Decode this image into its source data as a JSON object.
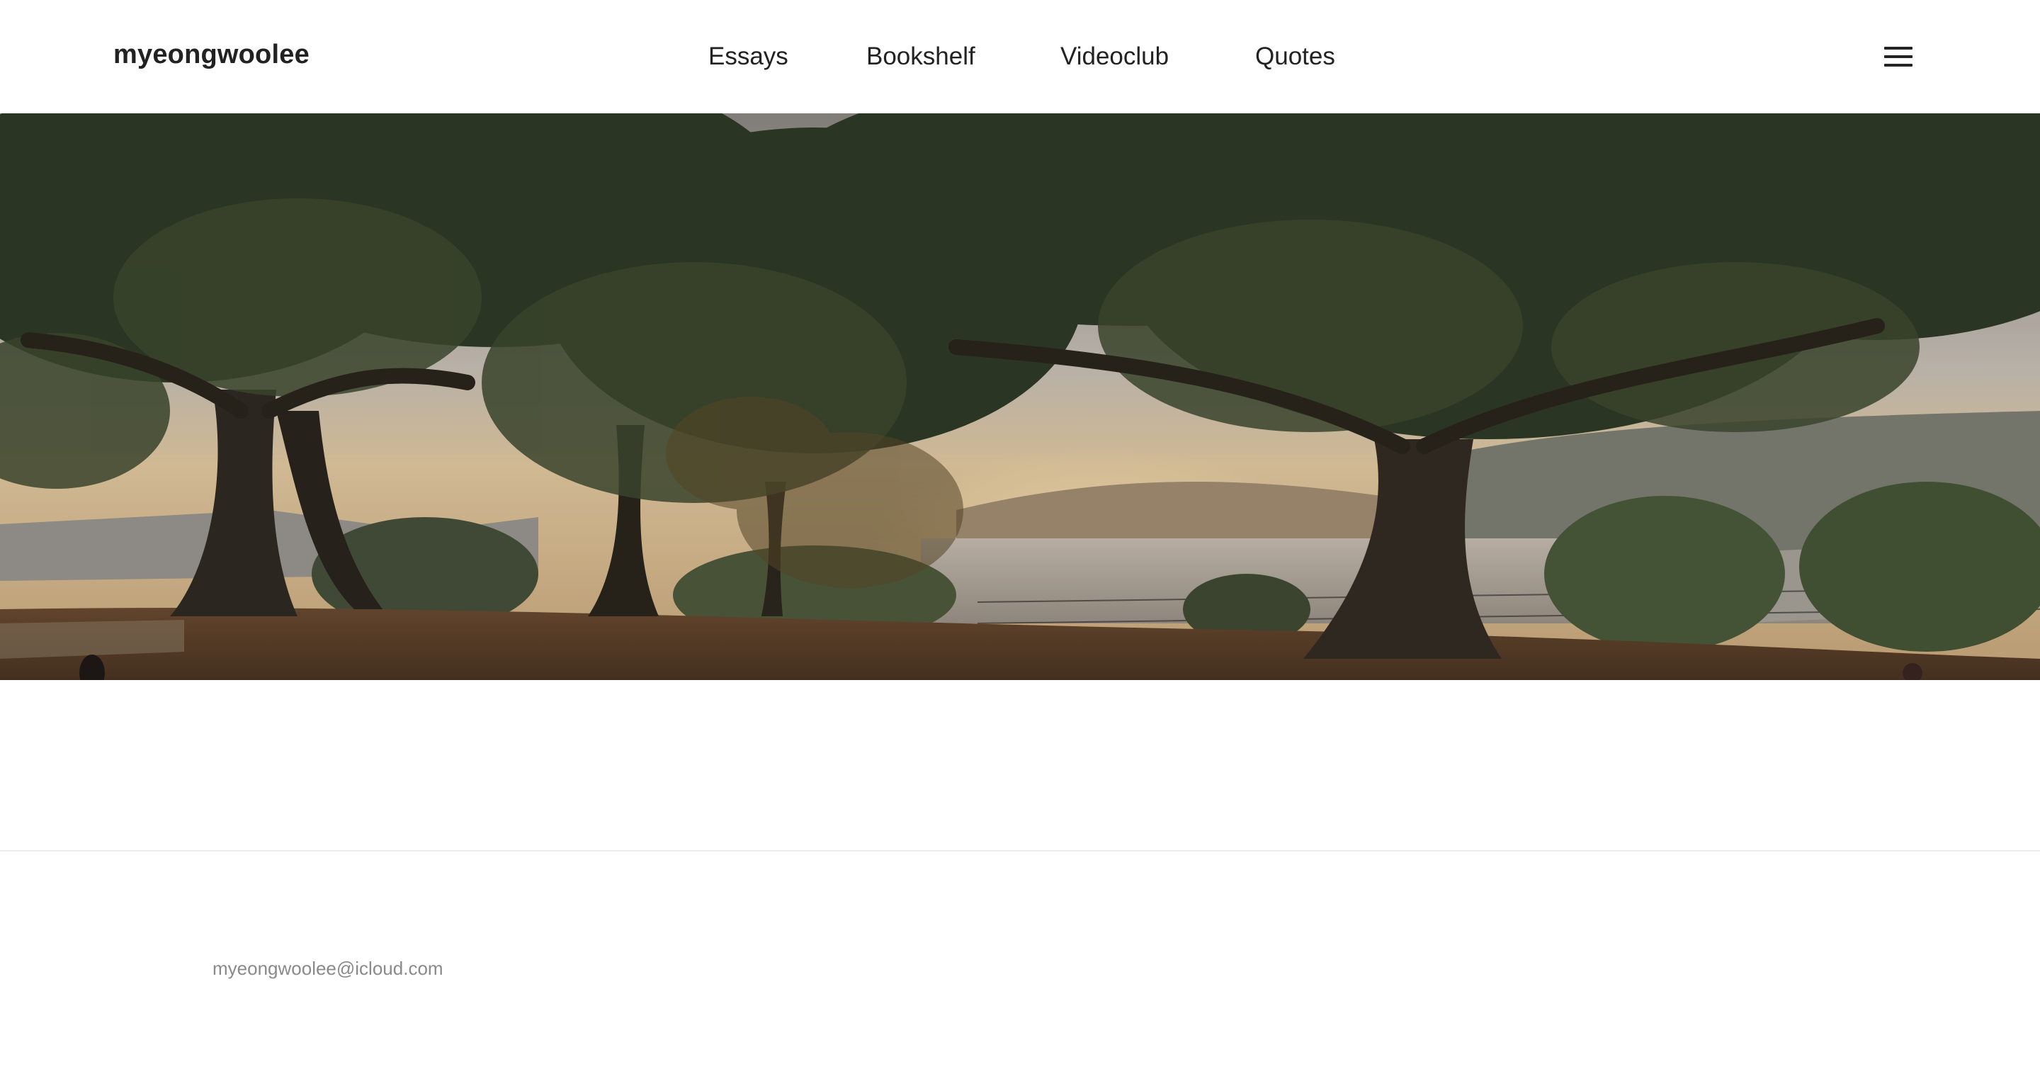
{
  "header": {
    "brand": "myeongwoolee",
    "nav": [
      {
        "label": "Essays"
      },
      {
        "label": "Bookshelf"
      },
      {
        "label": "Videoclub"
      },
      {
        "label": "Quotes"
      }
    ],
    "menu_icon": "hamburger-menu-icon"
  },
  "hero": {
    "image": "park-trees-harbour-sunset-photo"
  },
  "footer": {
    "email": "myeongwoolee@icloud.com"
  },
  "colors": {
    "text": "#222222",
    "footer_text": "#8a8a8a",
    "background": "#ffffff",
    "divider": "#ececec"
  }
}
